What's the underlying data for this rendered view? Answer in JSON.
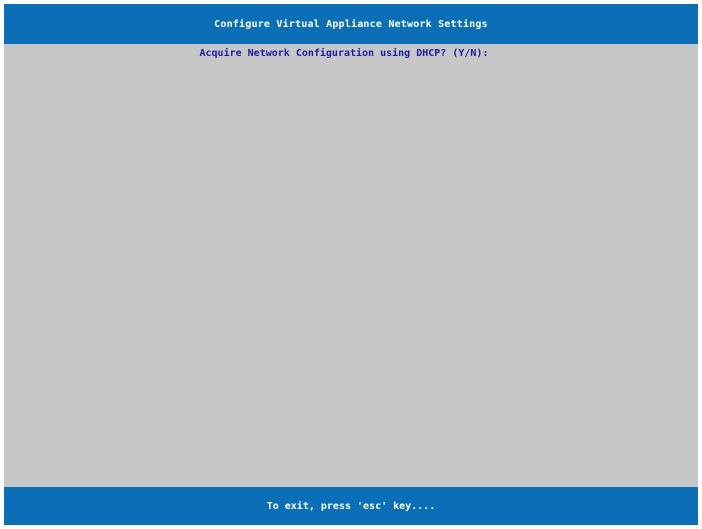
{
  "header": {
    "title": "Configure Virtual Appliance Network Settings"
  },
  "main": {
    "prompt": "Acquire Network Configuration using DHCP? (Y/N):",
    "input_value": ""
  },
  "footer": {
    "hint": "To exit, press 'esc' key...."
  },
  "colors": {
    "bar_blue": "#0a6fb6",
    "background_gray": "#c7c7c7",
    "prompt_text": "#1a1aa6",
    "bar_text": "#ffffff"
  }
}
